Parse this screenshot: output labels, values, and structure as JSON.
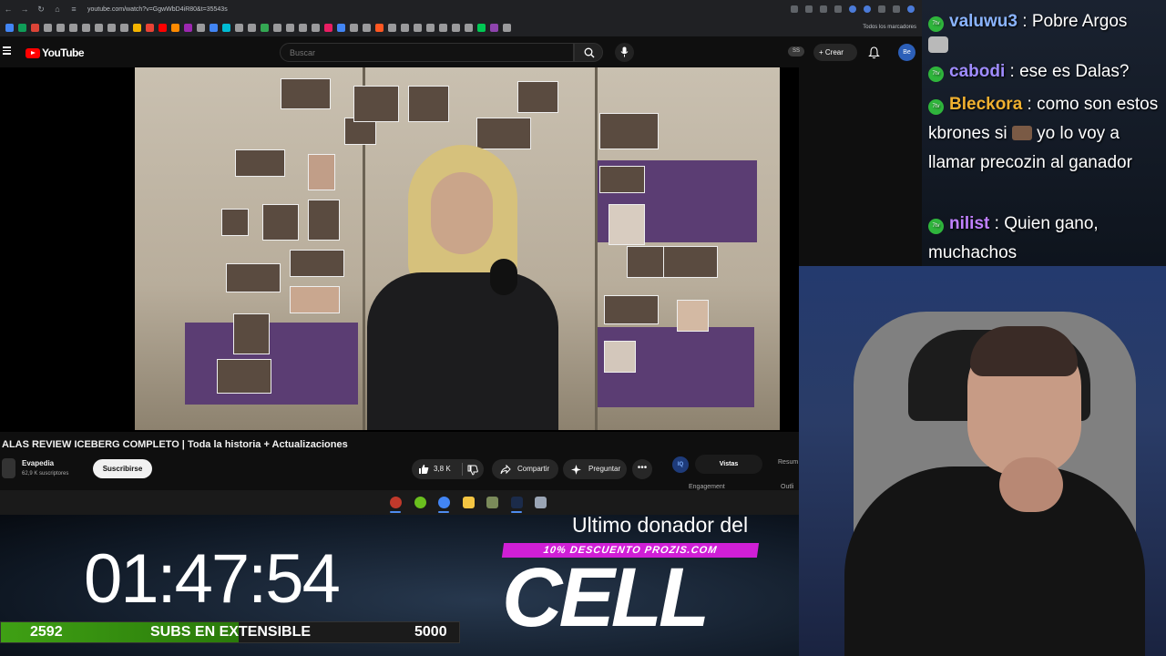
{
  "browser": {
    "url": "youtube.com/watch?v=GgwWbD4iR80&t=35543s",
    "bookmarks_folder": "Todos los marcadores",
    "bookmark_colors": [
      "#4285f4",
      "#0f9d58",
      "#db4437",
      "#ffffff",
      "#ffffff",
      "#ffffff",
      "#ffffff",
      "#ffffff",
      "#ffffff",
      "#ffffff",
      "#f4b400",
      "#ea4335",
      "#ff0000",
      "#ff8a00",
      "#9c27b0",
      "#ffffff",
      "#4285f4",
      "#00bcd4",
      "#ffffff",
      "#ffffff",
      "#34a853",
      "#ffffff",
      "#ffffff",
      "#ffffff",
      "#ffffff",
      "#e91e63",
      "#4285f4",
      "#ffffff",
      "#ffffff",
      "#ff5722",
      "#ffffff",
      "#ffffff",
      "#ffffff",
      "#ffffff",
      "#ffffff",
      "#ffffff",
      "#ffffff",
      "#00c853",
      "#8e44ad",
      "#ffffff"
    ]
  },
  "youtube": {
    "logo_text": "YouTube",
    "search_placeholder": "Buscar",
    "ss_badge": "SS",
    "create_label": "Crear",
    "avatar_text": "Be",
    "video_title": "ALAS REVIEW ICEBERG COMPLETO | Toda la historia + Actualizaciones",
    "channel_name": "Evapedia",
    "channel_subs": "62,9 K suscriptores",
    "subscribe_label": "Suscribirse",
    "like_count": "3,8 K",
    "share_label": "Compartir",
    "ask_label": "Preguntar",
    "iq_badge": "IQ",
    "tab_views": "Vistas",
    "tab_summary": "Resum",
    "engagement_label": "Engagement",
    "outlier_label": "Outli"
  },
  "taskbar": {
    "icons": [
      {
        "name": "obs-icon",
        "color": "#c0392b"
      },
      {
        "name": "xbox-icon",
        "color": "#6abf1e"
      },
      {
        "name": "chrome-icon",
        "color": "#4285f4"
      },
      {
        "name": "folder-icon",
        "color": "#f4c542"
      },
      {
        "name": "minecraft-icon",
        "color": "#7a8a5a"
      },
      {
        "name": "photoshop-icon",
        "color": "#1b2b4a"
      },
      {
        "name": "app-icon",
        "color": "#9aa5b5"
      }
    ]
  },
  "overlay": {
    "timer": "01:47:54",
    "subs_current": "2592",
    "subs_label": "SUBS EN EXTENSIBLE",
    "subs_goal": "5000",
    "subs_progress": 0.5184,
    "donor_title": "Ultimo donador del",
    "discount_text": "10% DESCUENTO PROZIS.COM",
    "donor_name": "CELL"
  },
  "chat": {
    "messages": [
      {
        "user": "valuwu3",
        "color": "#8ab4ff",
        "text": "Pobre Argos"
      },
      {
        "user": "cabodi",
        "color": "#9f8cff",
        "text": "ese es Dalas?"
      },
      {
        "user": "Bleckora",
        "color": "#f0b030",
        "text_before": "como son estos kbrones si",
        "text_after": "yo lo voy a llamar precozin al ganador"
      },
      {
        "user": "nilist",
        "color": "#c080ff",
        "text": "Quien gano, muchachos"
      }
    ],
    "badge_text": "7tv"
  }
}
